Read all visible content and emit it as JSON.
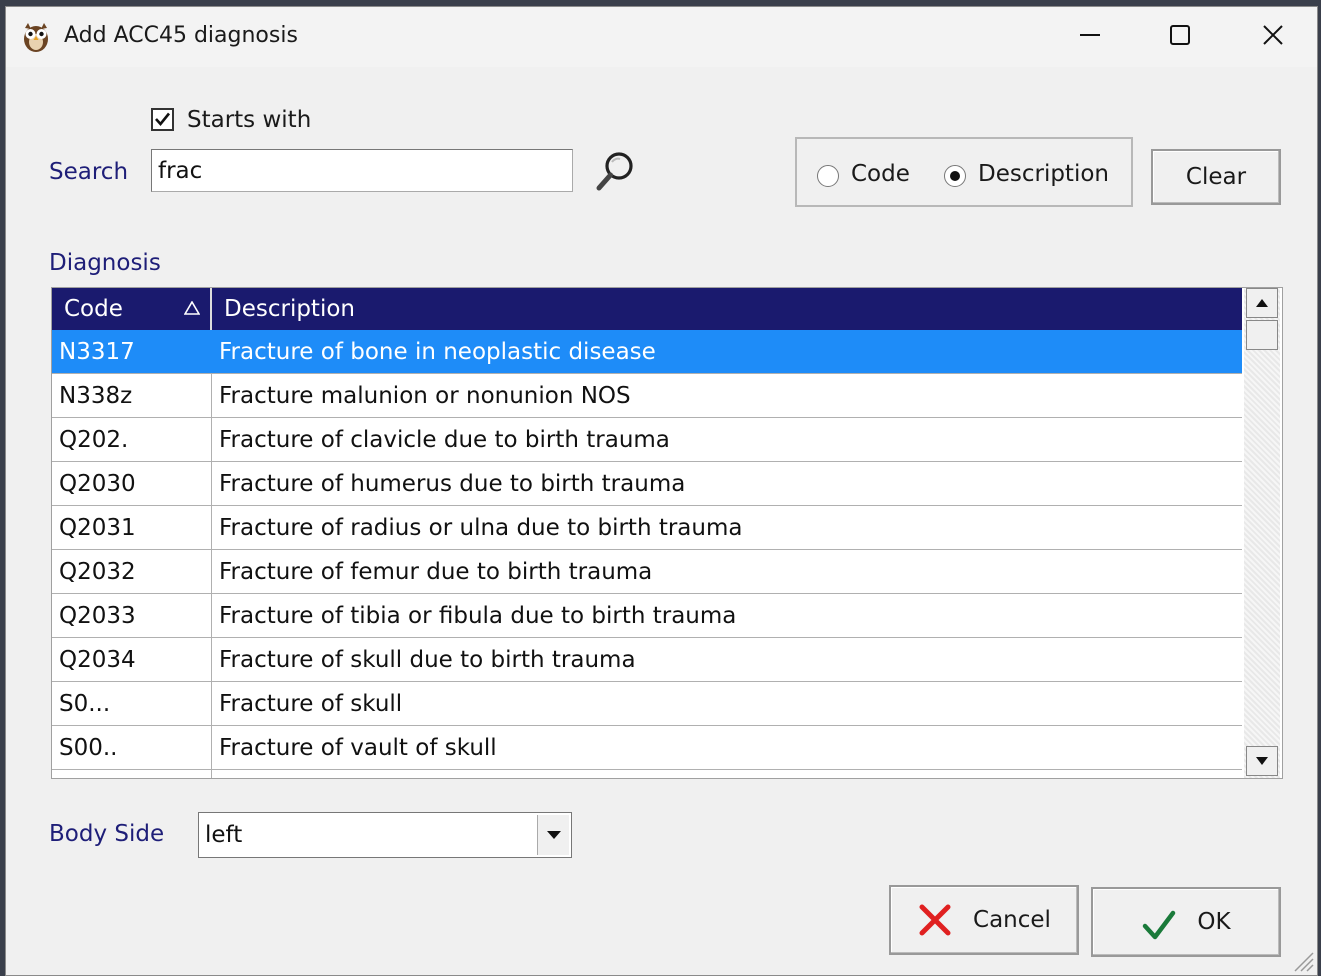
{
  "window": {
    "title": "Add ACC45 diagnosis"
  },
  "search": {
    "starts_with_label": "Starts with",
    "starts_with_checked": true,
    "label": "Search",
    "value": "frac",
    "mode_code_label": "Code",
    "mode_description_label": "Description",
    "selected_mode": "Description",
    "clear_label": "Clear"
  },
  "diagnosis": {
    "label": "Diagnosis",
    "columns": [
      "Code",
      "Description"
    ],
    "sort_column": "Code",
    "rows": [
      {
        "code": "N3317",
        "description": "Fracture of bone in neoplastic disease",
        "selected": true
      },
      {
        "code": "N338z",
        "description": "Fracture malunion or nonunion NOS"
      },
      {
        "code": "Q202.",
        "description": "Fracture of clavicle due to birth trauma"
      },
      {
        "code": "Q2030",
        "description": "Fracture of humerus due to birth trauma"
      },
      {
        "code": "Q2031",
        "description": "Fracture of radius or ulna due to birth trauma"
      },
      {
        "code": "Q2032",
        "description": "Fracture of femur due to birth trauma"
      },
      {
        "code": "Q2033",
        "description": "Fracture of tibia or fibula due to birth trauma"
      },
      {
        "code": "Q2034",
        "description": "Fracture of skull due to birth trauma"
      },
      {
        "code": "S0...",
        "description": "Fracture of skull"
      },
      {
        "code": "S00..",
        "description": "Fracture of vault of skull"
      }
    ]
  },
  "body_side": {
    "label": "Body Side",
    "value": "left"
  },
  "actions": {
    "cancel_label": "Cancel",
    "ok_label": "OK"
  },
  "colors": {
    "header_bg": "#1a1a6e",
    "selected_row": "#1e8cf8",
    "label_text": "#1e1e78",
    "cancel_icon": "#e02020",
    "ok_icon": "#1a7a3a"
  },
  "icons": {
    "app": "owl-icon",
    "search": "magnifier-icon",
    "cancel": "red-x-icon",
    "ok": "green-check-icon"
  }
}
